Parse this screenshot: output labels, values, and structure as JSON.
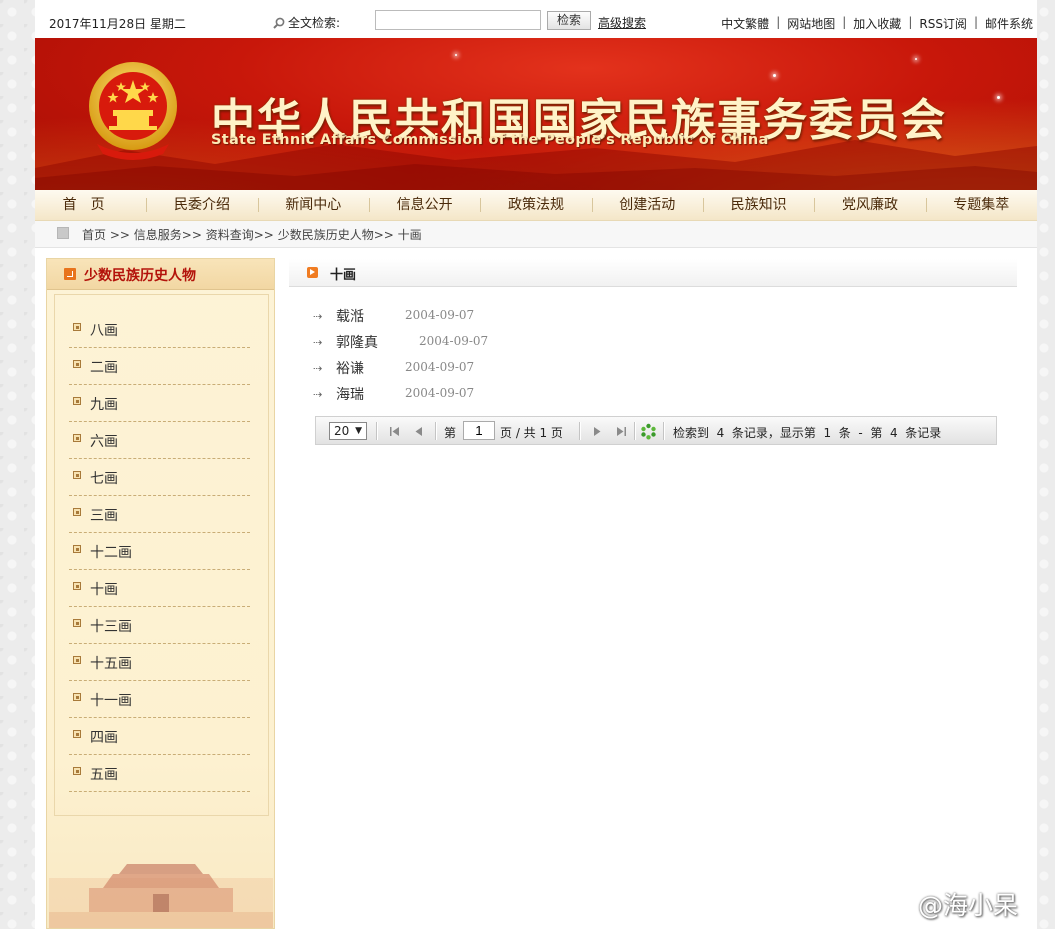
{
  "topbar": {
    "date": "2017年11月28日 星期二",
    "search_label": "全文检索:",
    "search_value": "",
    "search_button": "检索",
    "advanced_search": "高级搜索",
    "links": [
      "中文繁體",
      "网站地图",
      "加入收藏",
      "RSS订阅",
      "邮件系统"
    ]
  },
  "banner": {
    "title_cn": "中华人民共和国国家民族事务委员会",
    "title_en": "State Ethnic Affairs Commission of the People's Republic of China"
  },
  "nav": [
    "首页",
    "民委介绍",
    "新闻中心",
    "信息公开",
    "政策法规",
    "创建活动",
    "民族知识",
    "党风廉政",
    "专题集萃"
  ],
  "breadcrumb": {
    "items": [
      "首页",
      "信息服务",
      "资料查询",
      "少数民族历史人物",
      "十画"
    ],
    "separator": ">>"
  },
  "sidebar": {
    "title": "少数民族历史人物",
    "items": [
      "八画",
      "二画",
      "九画",
      "六画",
      "七画",
      "三画",
      "十二画",
      "十画",
      "十三画",
      "十五画",
      "十一画",
      "四画",
      "五画"
    ]
  },
  "main": {
    "title": "十画",
    "list": [
      {
        "name": "载湉",
        "date": "2004-09-07"
      },
      {
        "name": "郭隆真",
        "date": "2004-09-07"
      },
      {
        "name": "裕谦",
        "date": "2004-09-07"
      },
      {
        "name": "海瑞",
        "date": "2004-09-07"
      }
    ],
    "pager": {
      "page_size": "20",
      "page_prefix": "第",
      "current_page": "1",
      "page_suffix": "页 / 共 1 页",
      "summary": "检索到  4  条记录，显示第  1  条  -  第  4  条记录"
    }
  },
  "watermark": "@海小呆",
  "colors": {
    "banner_red": "#c8170a",
    "nav_text": "#4a2a0a",
    "sidebar_title": "#b3120a",
    "sidebar_bg": "#fdf3d6",
    "accent_orange": "#f07c22"
  }
}
